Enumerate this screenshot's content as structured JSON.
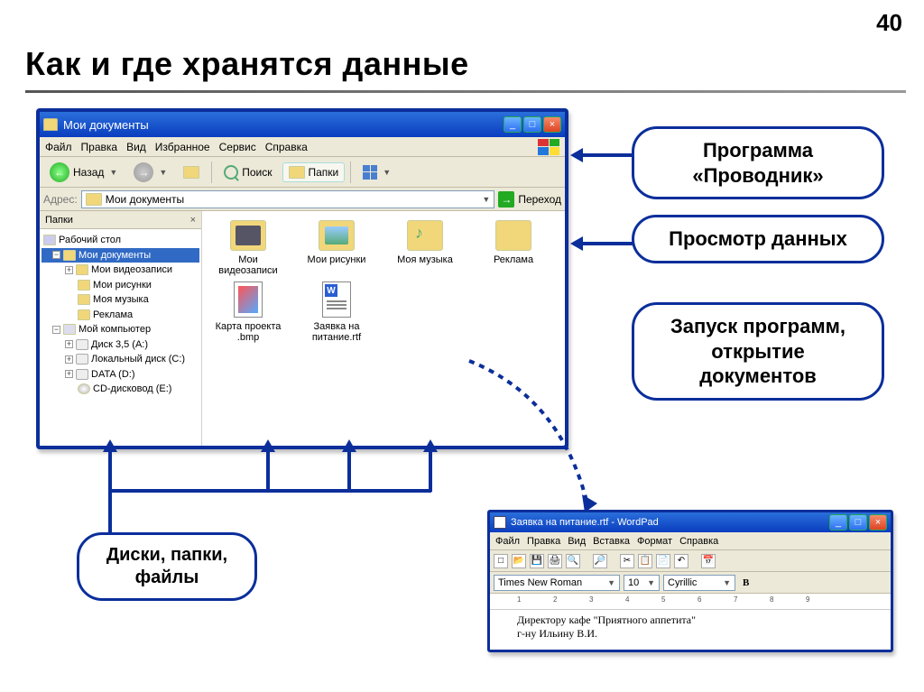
{
  "page_number": "40",
  "title": "Как и где хранятся данные",
  "explorer": {
    "window_title": "Мои документы",
    "menu": {
      "file": "Файл",
      "edit": "Правка",
      "view": "Вид",
      "favorites": "Избранное",
      "tools": "Сервис",
      "help": "Справка"
    },
    "toolbar": {
      "back": "Назад",
      "search": "Поиск",
      "folders": "Папки"
    },
    "address": {
      "label": "Адрес:",
      "value": "Мои документы",
      "go": "Переход"
    },
    "sidebar": {
      "header": "Папки",
      "tree": {
        "desktop": "Рабочий стол",
        "mydocs": "Мои документы",
        "videos": "Мои видеозаписи",
        "pictures": "Мои рисунки",
        "music": "Моя музыка",
        "ads": "Реклама",
        "mypc": "Мой компьютер",
        "floppy": "Диск 3,5 (A:)",
        "localc": "Локальный диск (C:)",
        "datad": "DATA (D:)",
        "cdrom": "CD-дисковод (E:)"
      }
    },
    "items": {
      "videos": "Мои видеозаписи",
      "pictures": "Мои рисунки",
      "music": "Моя музыка",
      "ads": "Реклама",
      "map": "Карта проекта .bmp",
      "request": "Заявка на питание.rtf"
    }
  },
  "callouts": {
    "c1": "Программа «Проводник»",
    "c2": "Просмотр данных",
    "c3": "Запуск программ, открытие документов",
    "c4": "Диски, папки, файлы"
  },
  "wordpad": {
    "title": "Заявка на питание.rtf - WordPad",
    "menu": {
      "file": "Файл",
      "edit": "Правка",
      "view": "Вид",
      "insert": "Вставка",
      "format": "Формат",
      "help": "Справка"
    },
    "font": "Times New Roman",
    "size": "10",
    "script": "Cyrillic",
    "bold": "B",
    "line1": "Директору кафе \"Приятного аппетита\"",
    "line2": "г-ну Ильину В.И."
  }
}
